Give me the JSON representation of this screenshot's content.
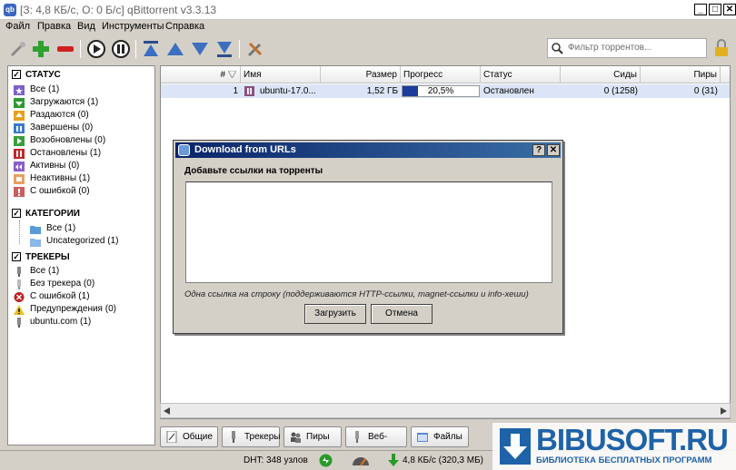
{
  "window": {
    "title": "[З: 4,8 КБ/с, О: 0 Б/с] qBittorrent v3.3.13"
  },
  "menu": [
    "Файл",
    "Правка",
    "Вид",
    "Инструменты",
    "Справка"
  ],
  "toolbar": {
    "buttons": [
      "add-link-icon",
      "add-torrent-icon",
      "remove-icon",
      "resume-icon",
      "pause-icon",
      "move-top-icon",
      "move-up-icon",
      "move-down-icon",
      "move-bottom-icon",
      "options-icon"
    ],
    "filter_placeholder": "Фильтр торрентов..."
  },
  "sidebar": {
    "status": {
      "label": "СТАТУС",
      "items": [
        "Все (1)",
        "Загружаются (1)",
        "Раздаются (0)",
        "Завершены (0)",
        "Возобновлены (0)",
        "Остановлены (1)",
        "Активны (0)",
        "Неактивны (1)",
        "С ошибкой (0)"
      ]
    },
    "categories": {
      "label": "КАТЕГОРИИ",
      "items": [
        "Все (1)",
        "Uncategorized (1)"
      ]
    },
    "trackers": {
      "label": "ТРЕКЕРЫ",
      "items": [
        "Все (1)",
        "Без трекера (0)",
        "С ошибкой (1)",
        "Предупреждения (0)",
        "ubuntu.com (1)"
      ]
    }
  },
  "list": {
    "columns": [
      "#",
      "Имя",
      "Размер",
      "Прогресс",
      "Статус",
      "Сиды",
      "Пиры"
    ],
    "rows": [
      {
        "num": "1",
        "name": "ubuntu-17.0...",
        "size": "1,52 ГБ",
        "progress_text": "20,5%",
        "progress": 0.205,
        "status": "Остановлен",
        "seeds": "0 (1258)",
        "peers": "0 (31)"
      }
    ]
  },
  "tabs": [
    "Общие",
    "Трекеры",
    "Пиры",
    "Веб-сиды",
    "Файлы"
  ],
  "statusbar": {
    "dht": "DHT: 348 узлов",
    "speed": "4,8 КБ/с (320,3 МБ)"
  },
  "dialog": {
    "title": "Download from URLs",
    "help": "?",
    "close": "✕",
    "heading": "Добавьте ссылки на торренты",
    "hint": "Одна ссылка на строку (поддерживаются HTTP-ссылки, magnet-ссылки и info-хеши)",
    "ok": "Загрузить",
    "cancel": "Отмена"
  },
  "watermark": {
    "brand": "BIBUSOFT.RU",
    "tagline": "БИБЛИОТЕКА БЕСПЛАТНЫХ ПРОГРАММ"
  }
}
